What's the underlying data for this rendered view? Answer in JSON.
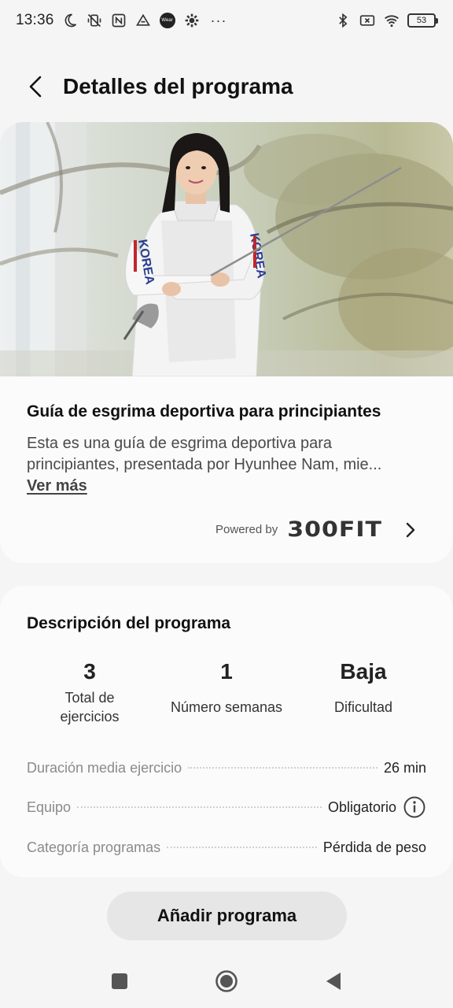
{
  "status_bar": {
    "time": "13:36",
    "left_icons": [
      "moon-icon",
      "vibrate-off-icon",
      "nfc-icon",
      "drive-icon",
      "wear-icon",
      "gear-icon"
    ],
    "wear_label": "Wear",
    "dots": "···",
    "right_icons": [
      "bluetooth-icon",
      "sim-x-icon",
      "wifi-icon",
      "battery-icon"
    ],
    "battery": "53"
  },
  "header": {
    "title": "Detalles del programa",
    "back_icon": "chevron-left-icon"
  },
  "program": {
    "title": "Guía de esgrima deportiva para principiantes",
    "description_line1": "Esta es una guía de esgrima deportiva para",
    "description_line2": "principiantes, presentada por Hyunhee Nam, mie...",
    "see_more": "Ver más",
    "powered_by": "Powered by",
    "brand": "300FIT",
    "jacket_text_left": "KOREA",
    "jacket_text_right": "KOREA"
  },
  "description": {
    "title": "Descripción del programa",
    "stats": [
      {
        "value": "3",
        "label_line1": "Total de",
        "label_line2": "ejercicios"
      },
      {
        "value": "1",
        "label_line1": "Número semanas",
        "label_line2": ""
      },
      {
        "value": "Baja",
        "label_line1": "Dificultad",
        "label_line2": ""
      }
    ],
    "details": [
      {
        "label": "Duración media ejercicio",
        "value": "26 min"
      },
      {
        "label": "Equipo",
        "value": "Obligatorio"
      },
      {
        "label": "Categoría programas",
        "value": "Pérdida de peso"
      }
    ]
  },
  "actions": {
    "add_program": "Añadir programa"
  },
  "colors": {
    "background": "#f5f5f5",
    "card": "#fbfbfb",
    "button": "#e6e6e6",
    "text_primary": "#111111",
    "text_secondary": "#8a8a8a"
  }
}
